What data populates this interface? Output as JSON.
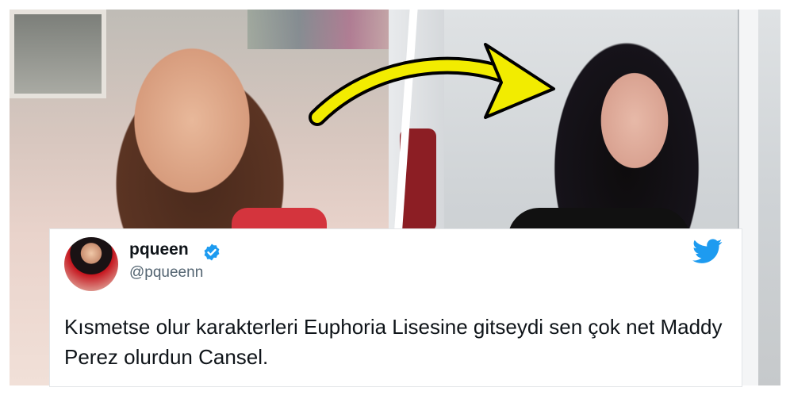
{
  "tweet": {
    "display_name": "pqueen",
    "handle": "@pqueenn",
    "text": "Kısmetse olur karakterleri Euphoria Lisesine gitseydi sen çok net Maddy Perez olurdun Cansel.",
    "verified": true
  },
  "colors": {
    "arrow": "#f2ec00",
    "twitter_blue": "#1d9bf0",
    "text": "#0f1419",
    "handle": "#536471"
  },
  "icons": {
    "verified": "verified-badge-icon",
    "brand": "twitter-bird-icon",
    "arrow": "curved-arrow-icon"
  }
}
